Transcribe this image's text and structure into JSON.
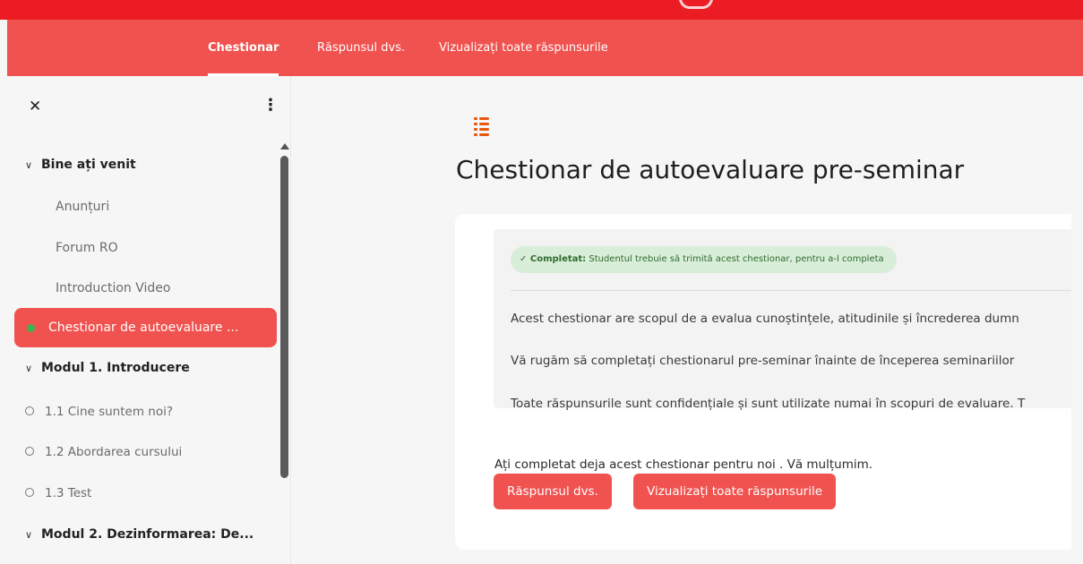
{
  "colors": {
    "top_bar": "#ec1c24",
    "accent": "#f0524f",
    "completed_badge": "#d9eed9",
    "active_dot": "#3cb54a"
  },
  "tabs": [
    {
      "label": "Chestionar",
      "active": true
    },
    {
      "label": "Răspunsul dvs.",
      "active": false
    },
    {
      "label": "Vizualizați toate răspunsurile",
      "active": false
    }
  ],
  "sidebar": {
    "close_icon": "close-icon",
    "more_icon": "more-vertical-icon",
    "items": [
      {
        "type": "section",
        "label": "Bine ați venit"
      },
      {
        "type": "link",
        "label": "Anunțuri"
      },
      {
        "type": "link",
        "label": "Forum RO"
      },
      {
        "type": "link",
        "label": "Introduction Video"
      },
      {
        "type": "active",
        "label": "Chestionar de autoevaluare ..."
      },
      {
        "type": "section",
        "label": "Modul 1. Introducere"
      },
      {
        "type": "sub",
        "label": "1.1 Cine suntem noi?"
      },
      {
        "type": "sub",
        "label": "1.2 Abordarea cursului"
      },
      {
        "type": "sub",
        "label": "1.3 Test"
      },
      {
        "type": "section",
        "label": "Modul 2. Dezinformarea: De..."
      }
    ]
  },
  "main": {
    "icon": "questionnaire-icon",
    "title": "Chestionar de autoevaluare pre-seminar",
    "badge": {
      "strong": "✓ Completat:",
      "text": " Studentul trebuie să trimită acest chestionar, pentru a-l completa"
    },
    "paragraphs": [
      "Acest chestionar are scopul de a evalua cunoștințele, atitudinile și încrederea dumn",
      "Vă rugăm să completați chestionarul pre-seminar înainte de începerea seminariilor",
      "Toate răspunsurile sunt confidențiale și sunt utilizate numai în scopuri de evaluare. T"
    ],
    "done_text": "Ați completat deja acest chestionar pentru noi . Vă mulțumim.",
    "buttons": {
      "your_response": "Răspunsul dvs.",
      "view_all": "Vizualizați toate răspunsurile"
    }
  }
}
